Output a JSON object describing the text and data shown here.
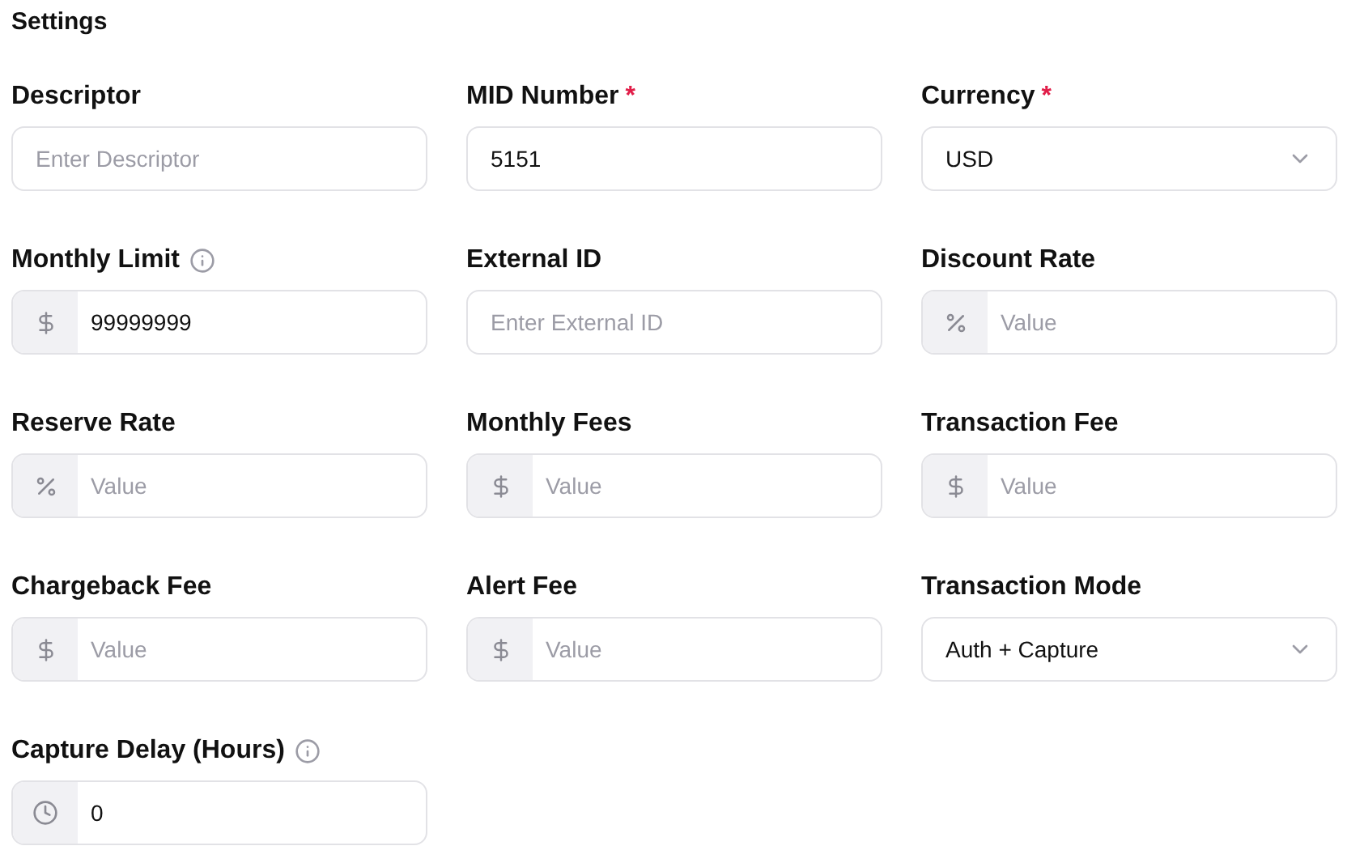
{
  "title": "Settings",
  "fields": [
    {
      "label": "Descriptor",
      "info": false,
      "kind": "text",
      "placeholder": "Enter Descriptor"
    },
    {
      "label": "MID Number",
      "required_mark": "*",
      "info": false,
      "kind": "text",
      "value": "5151"
    },
    {
      "label": "Currency",
      "required_mark": "*",
      "info": false,
      "kind": "select",
      "value": "USD"
    },
    {
      "label": "Monthly Limit",
      "info": true,
      "kind": "dollar",
      "value": "99999999"
    },
    {
      "label": "External ID",
      "info": false,
      "kind": "text",
      "placeholder": "Enter External ID"
    },
    {
      "label": "Discount Rate",
      "info": false,
      "kind": "percent",
      "placeholder": "Value"
    },
    {
      "label": "Reserve Rate",
      "info": false,
      "kind": "percent",
      "placeholder": "Value"
    },
    {
      "label": "Monthly Fees",
      "info": false,
      "kind": "dollar",
      "placeholder": "Value"
    },
    {
      "label": "Transaction Fee",
      "info": false,
      "kind": "dollar",
      "placeholder": "Value"
    },
    {
      "label": "Chargeback Fee",
      "info": false,
      "kind": "dollar",
      "placeholder": "Value"
    },
    {
      "label": "Alert Fee",
      "info": false,
      "kind": "dollar",
      "placeholder": "Value"
    },
    {
      "label": "Transaction Mode",
      "info": false,
      "kind": "select",
      "value": "Auth + Capture"
    },
    {
      "label": "Capture Delay (Hours)",
      "info": true,
      "kind": "clock",
      "value": "0"
    }
  ]
}
